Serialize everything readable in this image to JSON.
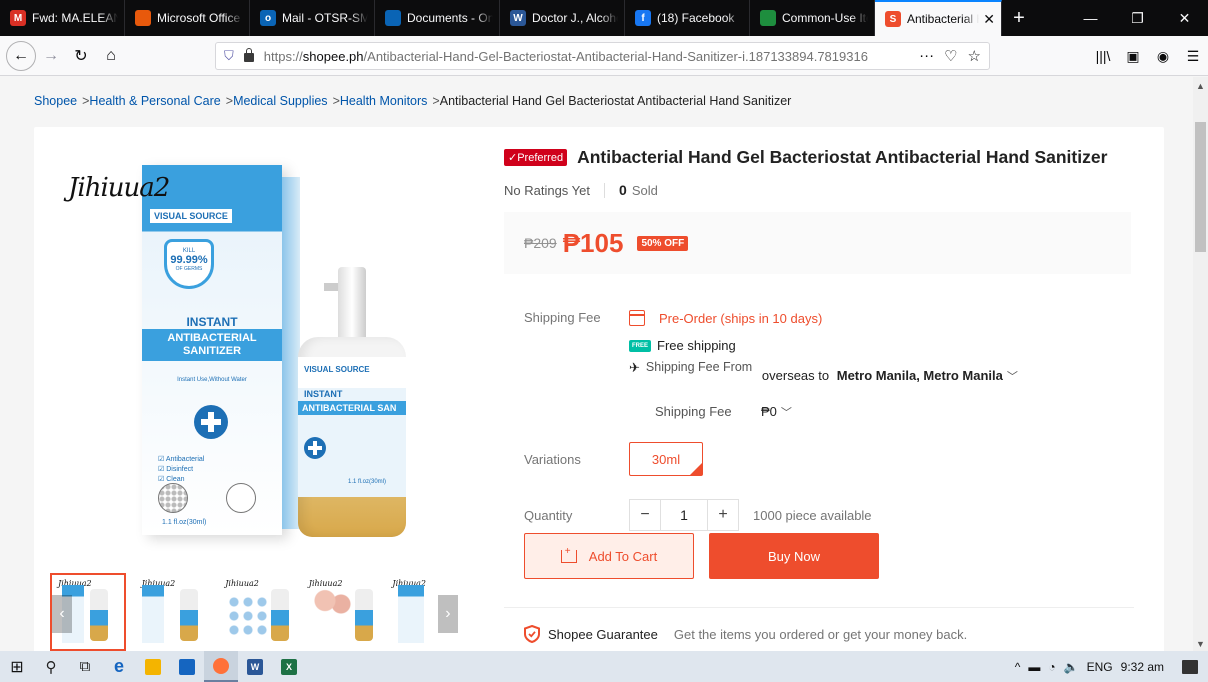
{
  "browser": {
    "tabs": [
      {
        "title": "Fwd: MA.ELEANO",
        "icon": "gmail-icon",
        "color": "#d93025",
        "glyph": "M"
      },
      {
        "title": "Microsoft Office",
        "icon": "office-icon",
        "color": "#e8590c",
        "glyph": ""
      },
      {
        "title": "Mail - OTSR-SMF",
        "icon": "outlook-icon",
        "color": "#0a64b5",
        "glyph": "o"
      },
      {
        "title": "Documents - One",
        "icon": "onedrive-icon",
        "color": "#0a64b5",
        "glyph": ""
      },
      {
        "title": "Doctor J., Alcoho",
        "icon": "word-icon",
        "color": "#2b5797",
        "glyph": "W"
      },
      {
        "title": "(18) Facebook",
        "icon": "facebook-icon",
        "color": "#1877f2",
        "glyph": "f"
      },
      {
        "title": "Common-Use Ite",
        "icon": "gdocs-icon",
        "color": "#1e8e3e",
        "glyph": ""
      },
      {
        "title": "Antibacterial Ha",
        "icon": "shopee-icon",
        "color": "#ee4d2d",
        "glyph": "S",
        "active": true
      }
    ],
    "url_prefix": "https://",
    "url_host": "shopee.ph",
    "url_path": "/Antibacterial-Hand-Gel-Bacteriostat-Antibacterial-Hand-Sanitizer-i.187133894.7819316",
    "url_more": "···"
  },
  "breadcrumb": [
    "Shopee",
    "Health & Personal Care",
    "Medical Supplies",
    "Health Monitors",
    "Antibacterial Hand Gel Bacteriostat Antibacterial Hand Sanitizer"
  ],
  "image": {
    "brand_script": "Jihiuua2",
    "box_brand": "VISUAL SOURCE",
    "kill_line1": "KILL",
    "kill_percent": "99.99%",
    "kill_line3": "OF GERMS",
    "instant": "INSTANT",
    "antibacterial": "ANTIBACTERIAL",
    "sanitizer": "SANITIZER",
    "usage": "Instant Use,Without Water",
    "features": [
      "Antibacterial",
      "Disinfect",
      "Clean"
    ],
    "before": "Before",
    "after": "After",
    "volume": "1.1 fl.oz(30ml)",
    "bottle_brand": "VISUAL SOURCE",
    "bottle_instant": "INSTANT",
    "bottle_anti": "ANTIBACTERIAL SAN",
    "bottle_volume": "1.1 fl.oz(30ml)"
  },
  "product": {
    "preferred_badge": "✓Preferred",
    "title": "Antibacterial Hand Gel Bacteriostat Antibacterial Hand Sanitizer",
    "ratings": "No Ratings Yet",
    "sold_count": "0",
    "sold_label": "Sold",
    "old_price": "₱209",
    "price": "₱105",
    "discount": "50% OFF"
  },
  "shipping": {
    "label": "Shipping Fee",
    "preorder": "Pre-Order (ships in 10 days)",
    "free_shipping": "Free shipping",
    "fee_from_label": "Shipping Fee From",
    "from": "overseas",
    "to_word": "to",
    "destination": "Metro Manila, Metro Manila",
    "fee_label": "Shipping Fee",
    "fee_value": "₱0"
  },
  "variations": {
    "label": "Variations",
    "selected": "30ml"
  },
  "quantity": {
    "label": "Quantity",
    "value": "1",
    "minus": "−",
    "plus": "+",
    "available": "1000 piece available"
  },
  "actions": {
    "add_to_cart": "Add To Cart",
    "buy_now": "Buy Now"
  },
  "guarantee": {
    "title": "Shopee Guarantee",
    "text": "Get the items you ordered or get your money back."
  },
  "taskbar": {
    "lang": "ENG",
    "time": "9:32 am"
  },
  "colors": {
    "brand": "#ee4d2d",
    "preferred": "#d0011b",
    "free_ship": "#00bfa5"
  }
}
